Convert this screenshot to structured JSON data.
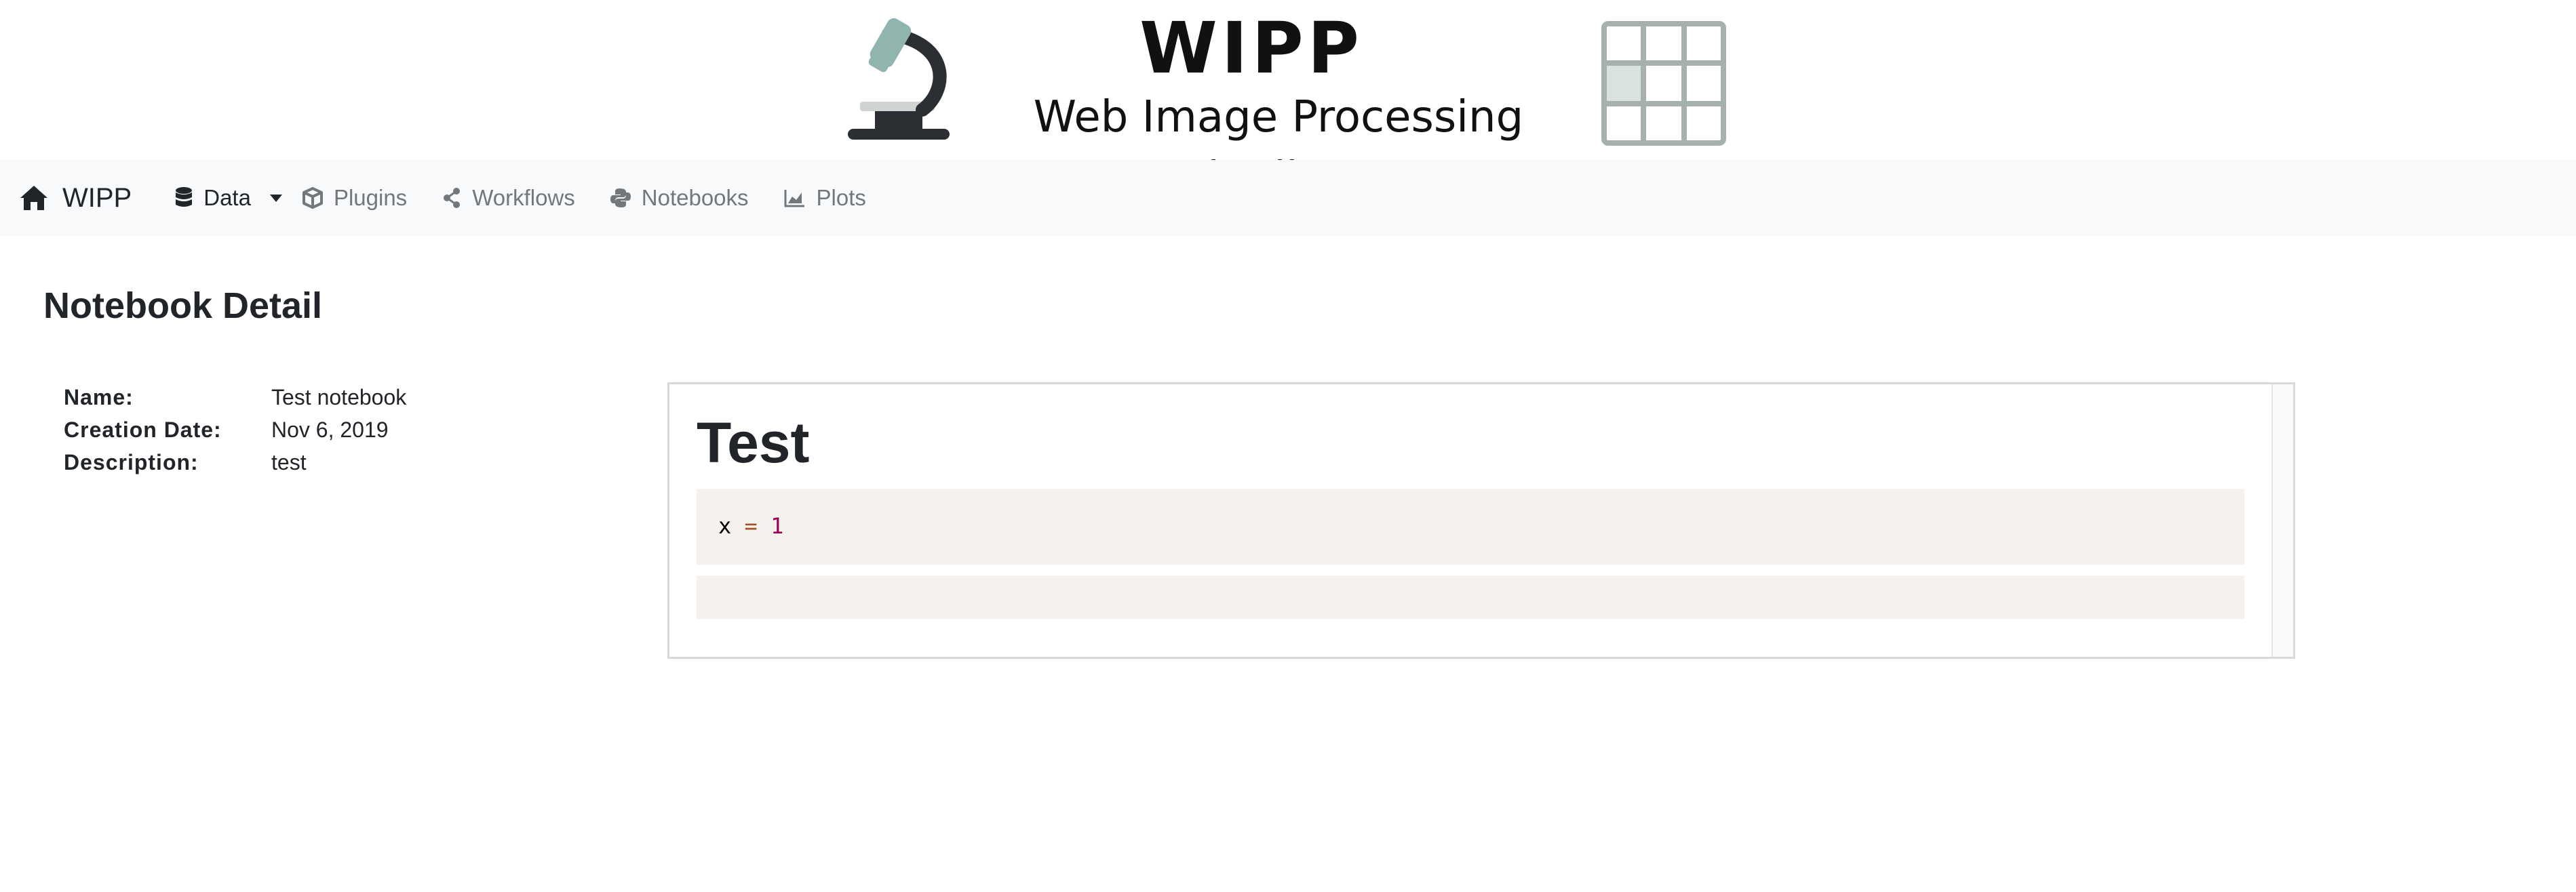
{
  "banner": {
    "title": "WIPP",
    "subtitle": "Web Image Processing Pipelines",
    "microscope_icon": "microscope-icon",
    "grid_icon": "image-grid-icon"
  },
  "navbar": {
    "brand": {
      "label": "WIPP",
      "icon": "home-icon"
    },
    "items": [
      {
        "label": "Data",
        "icon": "database-icon",
        "active": true,
        "has_dropdown": true
      },
      {
        "label": "Plugins",
        "icon": "cube-icon"
      },
      {
        "label": "Workflows",
        "icon": "share-icon"
      },
      {
        "label": "Notebooks",
        "icon": "python-icon"
      },
      {
        "label": "Plots",
        "icon": "chart-area-icon"
      }
    ],
    "background": "#f8f9fa"
  },
  "page": {
    "title": "Notebook Detail",
    "details": [
      {
        "key": "Name:",
        "value": "Test notebook"
      },
      {
        "key": "Creation Date:",
        "value": "Nov 6, 2019"
      },
      {
        "key": "Description:",
        "value": "test"
      }
    ]
  },
  "notebook": {
    "heading": "Test",
    "code": {
      "name": "x",
      "op": "=",
      "num": "1"
    },
    "cell_background": "#f5f1ed"
  }
}
